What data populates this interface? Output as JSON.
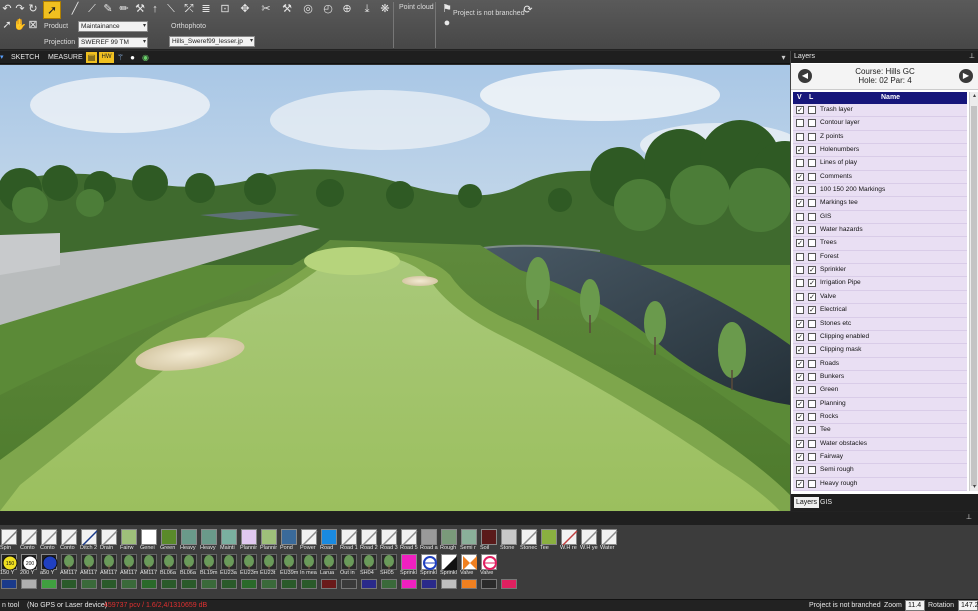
{
  "toolbar": {
    "product_label": "Product",
    "product_value": "Maintainance",
    "projection_label": "Projection",
    "projection_value": "SWEREF 99 TM",
    "orthophoto_label": "Orthophoto",
    "orthophoto_value": "Hills_Sweref99_lesser.jp",
    "point_cloud_label": "Point cloud",
    "branch_status": "Project is not branched"
  },
  "viewbar": {
    "sketch_label": "SKETCH",
    "measure_label": "MEASURE",
    "hw_label": "HW"
  },
  "layers_panel": {
    "title": "Layers",
    "course": "Course: Hills GC",
    "hole": "Hole: 02 Par: 4",
    "col_v": "V",
    "col_l": "L",
    "col_name": "Name",
    "rows": [
      {
        "name": "Trash layer",
        "v": true,
        "l": false
      },
      {
        "name": "Contour layer",
        "v": false,
        "l": false
      },
      {
        "name": "Z points",
        "v": false,
        "l": false
      },
      {
        "name": "Holenumbers",
        "v": true,
        "l": false
      },
      {
        "name": "Lines of play",
        "v": false,
        "l": false
      },
      {
        "name": "Comments",
        "v": true,
        "l": false
      },
      {
        "name": "100 150 200 Markings",
        "v": true,
        "l": false
      },
      {
        "name": "Markings tee",
        "v": true,
        "l": false
      },
      {
        "name": "GIS",
        "v": false,
        "l": false
      },
      {
        "name": "Water hazards",
        "v": true,
        "l": false
      },
      {
        "name": "Trees",
        "v": true,
        "l": false
      },
      {
        "name": "Forest",
        "v": false,
        "l": false
      },
      {
        "name": "Sprinkler",
        "v": false,
        "l": true
      },
      {
        "name": "Irrigation Pipe",
        "v": false,
        "l": true
      },
      {
        "name": "Valve",
        "v": false,
        "l": true
      },
      {
        "name": "Electrical",
        "v": false,
        "l": true
      },
      {
        "name": "Stones etc",
        "v": true,
        "l": false
      },
      {
        "name": "Clipping enabled",
        "v": true,
        "l": false
      },
      {
        "name": "Clipping mask",
        "v": true,
        "l": false
      },
      {
        "name": "Roads",
        "v": true,
        "l": false
      },
      {
        "name": "Bunkers",
        "v": true,
        "l": false
      },
      {
        "name": "Green",
        "v": true,
        "l": false
      },
      {
        "name": "Planning",
        "v": true,
        "l": false
      },
      {
        "name": "Rocks",
        "v": true,
        "l": false
      },
      {
        "name": "Tee",
        "v": true,
        "l": false
      },
      {
        "name": "Water obstacles",
        "v": true,
        "l": false
      },
      {
        "name": "Fairway",
        "v": true,
        "l": false
      },
      {
        "name": "Semi rough",
        "v": true,
        "l": false
      },
      {
        "name": "Heavy rough",
        "v": true,
        "l": false
      }
    ],
    "tabs": [
      "Layers",
      "GIS"
    ]
  },
  "palette": {
    "row1": [
      {
        "cap": "Spin",
        "color": "#7a7a7a",
        "kind": "line"
      },
      {
        "cap": "Conto",
        "color": "#8a8a8a",
        "kind": "line"
      },
      {
        "cap": "Conto",
        "color": "#8a8a8a",
        "kind": "line"
      },
      {
        "cap": "Conto",
        "color": "#8a8a8a",
        "kind": "line"
      },
      {
        "cap": "Ditch 2",
        "color": "#1a3a8a",
        "kind": "line"
      },
      {
        "cap": "Drain",
        "color": "#8a8a8a",
        "kind": "line"
      },
      {
        "cap": "Fairw",
        "color": "#9ec07a",
        "kind": "box"
      },
      {
        "cap": "Genei",
        "color": "#ffffff",
        "kind": "box"
      },
      {
        "cap": "Green",
        "color": "#5a8a2a",
        "kind": "box"
      },
      {
        "cap": "Heavy",
        "color": "#6a9a8a",
        "kind": "box"
      },
      {
        "cap": "Heavy",
        "color": "#6a9a8a",
        "kind": "box"
      },
      {
        "cap": "Mainti",
        "color": "#7ab0a0",
        "kind": "box"
      },
      {
        "cap": "Plannir",
        "color": "#e0c8f0",
        "kind": "box"
      },
      {
        "cap": "Plannir",
        "color": "#9ec07a",
        "kind": "box"
      },
      {
        "cap": "Pond",
        "color": "#3a6a9a",
        "kind": "box"
      },
      {
        "cap": "Power",
        "color": "#8a8a8a",
        "kind": "line"
      },
      {
        "cap": "Road",
        "color": "#1a8ae0",
        "kind": "box"
      },
      {
        "cap": "Road 1",
        "color": "#8a8a8a",
        "kind": "line"
      },
      {
        "cap": "Road 2",
        "color": "#8a8a8a",
        "kind": "line"
      },
      {
        "cap": "Road 3",
        "color": "#8a8a8a",
        "kind": "line"
      },
      {
        "cap": "Road 5",
        "color": "#8a8a8a",
        "kind": "line"
      },
      {
        "cap": "Road a",
        "color": "#9a9a9a",
        "kind": "box"
      },
      {
        "cap": "Rough",
        "color": "#7a9a7a",
        "kind": "box"
      },
      {
        "cap": "Semi r",
        "color": "#8ab09a",
        "kind": "box"
      },
      {
        "cap": "Soil",
        "color": "#5a1a1a",
        "kind": "box"
      },
      {
        "cap": "Stone",
        "color": "#c8c8c8",
        "kind": "box"
      },
      {
        "cap": "Stonec",
        "color": "#8a8a8a",
        "kind": "line"
      },
      {
        "cap": "Tee",
        "color": "#8ab040",
        "kind": "box"
      },
      {
        "cap": "W.H re",
        "color": "#c04040",
        "kind": "line"
      },
      {
        "cap": "W.H ye",
        "color": "#8a8a8a",
        "kind": "line"
      },
      {
        "cap": "Water",
        "color": "#8a8a8a",
        "kind": "line"
      }
    ],
    "row2": [
      {
        "cap": "150 Y",
        "kind": "disc",
        "color": "#f0e020",
        "text": "150"
      },
      {
        "cap": "200 Y",
        "kind": "disc",
        "color": "#ffffff",
        "text": "200"
      },
      {
        "cap": "a50 Y",
        "kind": "disc",
        "color": "#2040c0",
        "text": ""
      },
      {
        "cap": "AM117",
        "kind": "tree"
      },
      {
        "cap": "AM117",
        "kind": "tree"
      },
      {
        "cap": "AM117",
        "kind": "tree"
      },
      {
        "cap": "AM117",
        "kind": "tree"
      },
      {
        "cap": "AM117",
        "kind": "tree"
      },
      {
        "cap": "BL06a",
        "kind": "tree"
      },
      {
        "cap": "BL06a",
        "kind": "tree"
      },
      {
        "cap": "BL19m",
        "kind": "tree"
      },
      {
        "cap": "EU23a",
        "kind": "tree"
      },
      {
        "cap": "EU23m",
        "kind": "tree"
      },
      {
        "cap": "EU23t",
        "kind": "tree"
      },
      {
        "cap": "EU39m",
        "kind": "tree"
      },
      {
        "cap": "In mea",
        "kind": "tree"
      },
      {
        "cap": "Larua",
        "kind": "tree"
      },
      {
        "cap": "Out in",
        "kind": "tree"
      },
      {
        "cap": "SH04",
        "kind": "tree"
      },
      {
        "cap": "SH05",
        "kind": "tree"
      },
      {
        "cap": "Sprinkl",
        "kind": "flat",
        "color": "#f020c0"
      },
      {
        "cap": "Sprinkl",
        "kind": "ring",
        "color": "#2040c0"
      },
      {
        "cap": "Sprinkl",
        "kind": "half",
        "color": "#111111"
      },
      {
        "cap": "Valve",
        "kind": "bow",
        "color": "#f08020"
      },
      {
        "cap": "Valve",
        "kind": "ring",
        "color": "#e02060"
      }
    ],
    "row3_colors": [
      "#1a3a8a",
      "#b0b0b0",
      "#40a040",
      "#2a5a2a",
      "#3a6a3a",
      "#2a5a2a",
      "#3a6a3a",
      "#2a6a2a",
      "#2a5a2a",
      "#2a5a2a",
      "#3a6a3a",
      "#2a5a2a",
      "#2a6a2a",
      "#3a6a3a",
      "#2a5a2a",
      "#2a5a2a",
      "#6a1a1a",
      "#3a3a3a",
      "#2a2a8a",
      "#3a6a3a",
      "#f020c0",
      "#2a2a8a",
      "#c0c0c0",
      "#f08020",
      "#2a2a2a",
      "#e02060"
    ]
  },
  "status": {
    "tool_text": "n tool",
    "gps_text": "(No GPS or Laser device)",
    "coords_text": "459737 pcv / 1.6/2,4/1310659 dB",
    "branch_text": "Project is not branched",
    "zoom_label": "Zoom",
    "zoom_value": "11.4",
    "rotation_label": "Rotation",
    "rotation_value": "147.2"
  }
}
